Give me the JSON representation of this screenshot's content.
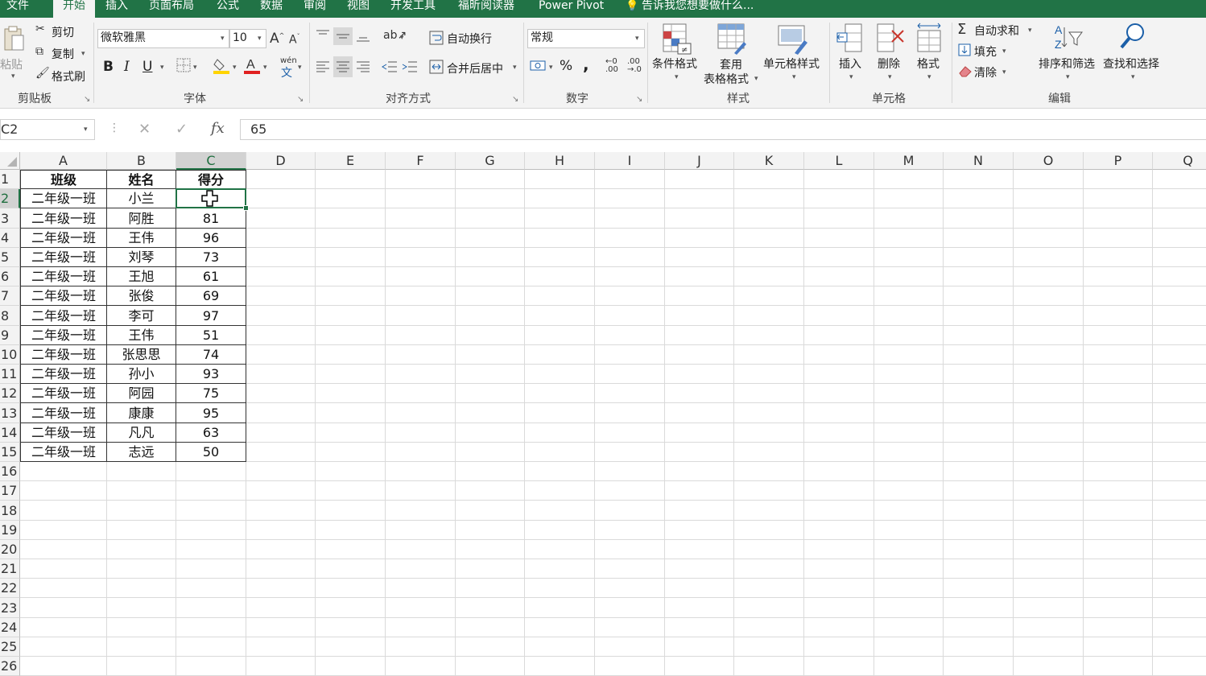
{
  "menu": {
    "tabs": [
      {
        "label": "文件"
      },
      {
        "label": "开始",
        "active": true
      },
      {
        "label": "插入"
      },
      {
        "label": "页面布局"
      },
      {
        "label": "公式"
      },
      {
        "label": "数据"
      },
      {
        "label": "审阅"
      },
      {
        "label": "视图"
      },
      {
        "label": "开发工具"
      },
      {
        "label": "福昕阅读器"
      },
      {
        "label": "Power Pivot"
      }
    ],
    "tell_me": "告诉我您想要做什么..."
  },
  "ribbon": {
    "clipboard": {
      "paste": "粘贴",
      "cut": "剪切",
      "copy": "复制",
      "format_painter": "格式刷",
      "group": "剪贴板"
    },
    "font": {
      "name": "微软雅黑",
      "size": "10",
      "bold": "B",
      "italic": "I",
      "underline": "U",
      "pinyin_top": "wén",
      "pinyin_bottom": "文",
      "group": "字体"
    },
    "alignment": {
      "wrap": "自动换行",
      "merge": "合并后居中",
      "group": "对齐方式"
    },
    "number": {
      "format": "常规",
      "percent": "%",
      "comma": ",",
      "group": "数字"
    },
    "styles": {
      "conditional": "条件格式",
      "table_line1": "套用",
      "table_line2": "表格格式",
      "cell_styles": "单元格样式",
      "group": "样式"
    },
    "cells": {
      "insert": "插入",
      "delete": "删除",
      "format": "格式",
      "group": "单元格"
    },
    "editing": {
      "autosum": "自动求和",
      "fill": "填充",
      "clear": "清除",
      "sort": "排序和筛选",
      "find": "查找和选择",
      "group": "编辑"
    }
  },
  "formula_bar": {
    "name_box": "C2",
    "value": "65"
  },
  "sheet": {
    "columns": [
      "A",
      "B",
      "C",
      "D",
      "E",
      "F",
      "G",
      "H",
      "I",
      "J",
      "K",
      "L",
      "M",
      "N",
      "O",
      "P",
      "Q"
    ],
    "row_numbers": [
      "1",
      "2",
      "3",
      "4",
      "5",
      "6",
      "7",
      "8",
      "9",
      "10",
      "11",
      "12",
      "13",
      "14",
      "15",
      "16",
      "17",
      "18",
      "19",
      "20",
      "21",
      "22",
      "23",
      "24",
      "25",
      "26"
    ],
    "selected_cell": "C2",
    "table": {
      "headers": [
        "班级",
        "姓名",
        "得分"
      ],
      "rows": [
        [
          "二年级一班",
          "小兰",
          ""
        ],
        [
          "二年级一班",
          "阿胜",
          "81"
        ],
        [
          "二年级一班",
          "王伟",
          "96"
        ],
        [
          "二年级一班",
          "刘琴",
          "73"
        ],
        [
          "二年级一班",
          "王旭",
          "61"
        ],
        [
          "二年级一班",
          "张俊",
          "69"
        ],
        [
          "二年级一班",
          "李可",
          "97"
        ],
        [
          "二年级一班",
          "王伟",
          "51"
        ],
        [
          "二年级一班",
          "张思思",
          "74"
        ],
        [
          "二年级一班",
          "孙小",
          "93"
        ],
        [
          "二年级一班",
          "阿园",
          "75"
        ],
        [
          "二年级一班",
          "康康",
          "95"
        ],
        [
          "二年级一班",
          "凡凡",
          "63"
        ],
        [
          "二年级一班",
          "志远",
          "50"
        ]
      ]
    }
  },
  "colors": {
    "accent": "#217346",
    "ribbon_bg": "#f3f3f3",
    "header_bg": "#f3f3f3",
    "selected_header_bg": "#d2d2d2"
  }
}
